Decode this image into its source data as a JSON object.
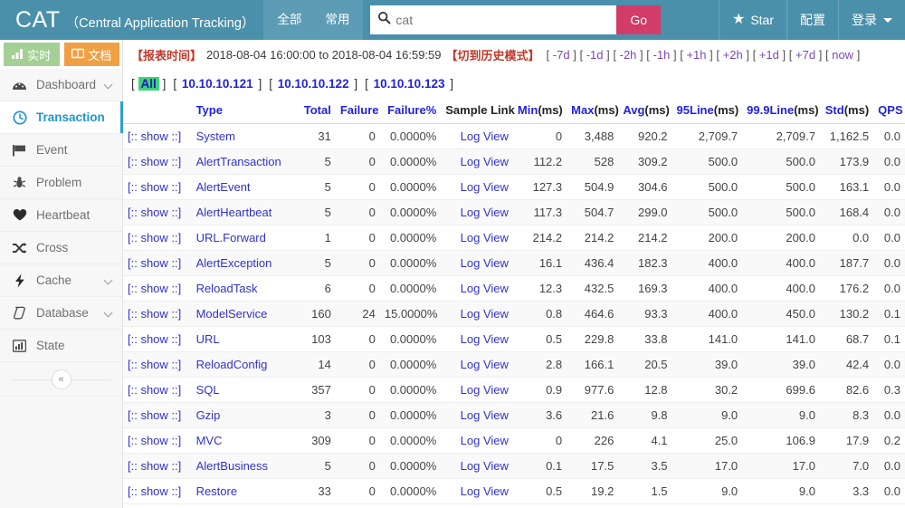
{
  "header": {
    "brand_short": "CAT",
    "brand_full": "（Central Application Tracking）",
    "nav_quick": [
      {
        "label": "全部",
        "name": "nav-all"
      },
      {
        "label": "常用",
        "name": "nav-common"
      }
    ],
    "search": {
      "icon": "search-icon",
      "value": "cat",
      "placeholder": "cat",
      "go_label": "Go",
      "go_color": "#d33b68"
    },
    "right_items": [
      {
        "label": "Star",
        "icon": "star-icon"
      },
      {
        "label": "配置",
        "icon": null
      },
      {
        "label": "登录",
        "icon": "chevron-down-icon"
      }
    ],
    "bg_color": "#4a90ab"
  },
  "sidebar": {
    "tab_buttons": [
      {
        "label": "实时",
        "icon": "bar-chart-icon",
        "color": "#a4cf95"
      },
      {
        "label": "文档",
        "icon": "book-icon",
        "color": "#f0a044"
      }
    ],
    "items": [
      {
        "label": "Dashboard",
        "icon": "dashboard-icon",
        "active": false,
        "expandable": true
      },
      {
        "label": "Transaction",
        "icon": "clock-icon",
        "active": true,
        "expandable": false
      },
      {
        "label": "Event",
        "icon": "flag-icon",
        "active": false,
        "expandable": false
      },
      {
        "label": "Problem",
        "icon": "bug-icon",
        "active": false,
        "expandable": false
      },
      {
        "label": "Heartbeat",
        "icon": "heart-icon",
        "active": false,
        "expandable": false
      },
      {
        "label": "Cross",
        "icon": "shuffle-icon",
        "active": false,
        "expandable": false
      },
      {
        "label": "Cache",
        "icon": "lightning-icon",
        "active": false,
        "expandable": true
      },
      {
        "label": "Database",
        "icon": "database-icon",
        "active": false,
        "expandable": true
      },
      {
        "label": "State",
        "icon": "chart-icon",
        "active": false,
        "expandable": false
      }
    ],
    "collapse_glyph": "«",
    "active_color": "#2196c9"
  },
  "toolbar": {
    "report_time_label": "【报表时间】",
    "time_range": "2018-08-04 16:00:00 to 2018-08-04 16:59:59",
    "history_mode_label": "【切到历史模式】",
    "jumps": [
      "-7d",
      "-1d",
      "-2h",
      "-1h",
      "+1h",
      "+2h",
      "+1d",
      "+7d",
      "now"
    ]
  },
  "ip_filter": {
    "items": [
      {
        "label": "All",
        "selected": true
      },
      {
        "label": "10.10.10.121",
        "selected": false
      },
      {
        "label": "10.10.10.122",
        "selected": false
      },
      {
        "label": "10.10.10.123",
        "selected": false
      }
    ],
    "selected_bg": "#3ed37e"
  },
  "table": {
    "columns": [
      {
        "key": "show",
        "label": "",
        "link": false,
        "align": "left"
      },
      {
        "key": "type",
        "label": "Type",
        "link": true,
        "align": "left"
      },
      {
        "key": "total",
        "label": "Total",
        "link": true,
        "align": "right"
      },
      {
        "key": "failure",
        "label": "Failure",
        "link": true,
        "align": "right"
      },
      {
        "key": "failure_pct",
        "label": "Failure%",
        "link": true,
        "align": "right"
      },
      {
        "key": "sample_link",
        "label": "Sample Link",
        "link": false,
        "align": "right"
      },
      {
        "key": "min",
        "label": "Min",
        "unit": "(ms)",
        "link": true,
        "align": "right"
      },
      {
        "key": "max",
        "label": "Max",
        "unit": "(ms)",
        "link": true,
        "align": "right"
      },
      {
        "key": "avg",
        "label": "Avg",
        "unit": "(ms)",
        "link": true,
        "align": "right"
      },
      {
        "key": "line95",
        "label": "95Line",
        "unit": "(ms)",
        "link": true,
        "align": "right"
      },
      {
        "key": "line999",
        "label": "99.9Line",
        "unit": "(ms)",
        "link": true,
        "align": "right"
      },
      {
        "key": "std",
        "label": "Std",
        "unit": "(ms)",
        "link": true,
        "align": "right"
      },
      {
        "key": "qps",
        "label": "QPS",
        "link": true,
        "align": "right"
      }
    ],
    "show_label": "[:: show ::]",
    "sample_link_label": "Log View",
    "rows": [
      {
        "type": "System",
        "total": "31",
        "failure": "0",
        "failure_pct": "0.0000%",
        "min": "0",
        "max": "3,488",
        "avg": "920.2",
        "line95": "2,709.7",
        "line999": "2,709.7",
        "std": "1,162.5",
        "qps": "0.0"
      },
      {
        "type": "AlertTransaction",
        "total": "5",
        "failure": "0",
        "failure_pct": "0.0000%",
        "min": "112.2",
        "max": "528",
        "avg": "309.2",
        "line95": "500.0",
        "line999": "500.0",
        "std": "173.9",
        "qps": "0.0"
      },
      {
        "type": "AlertEvent",
        "total": "5",
        "failure": "0",
        "failure_pct": "0.0000%",
        "min": "127.3",
        "max": "504.9",
        "avg": "304.6",
        "line95": "500.0",
        "line999": "500.0",
        "std": "163.1",
        "qps": "0.0"
      },
      {
        "type": "AlertHeartbeat",
        "total": "5",
        "failure": "0",
        "failure_pct": "0.0000%",
        "min": "117.3",
        "max": "504.7",
        "avg": "299.0",
        "line95": "500.0",
        "line999": "500.0",
        "std": "168.4",
        "qps": "0.0"
      },
      {
        "type": "URL.Forward",
        "total": "1",
        "failure": "0",
        "failure_pct": "0.0000%",
        "min": "214.2",
        "max": "214.2",
        "avg": "214.2",
        "line95": "200.0",
        "line999": "200.0",
        "std": "0.0",
        "qps": "0.0"
      },
      {
        "type": "AlertException",
        "total": "5",
        "failure": "0",
        "failure_pct": "0.0000%",
        "min": "16.1",
        "max": "436.4",
        "avg": "182.3",
        "line95": "400.0",
        "line999": "400.0",
        "std": "187.7",
        "qps": "0.0"
      },
      {
        "type": "ReloadTask",
        "total": "6",
        "failure": "0",
        "failure_pct": "0.0000%",
        "min": "12.3",
        "max": "432.5",
        "avg": "169.3",
        "line95": "400.0",
        "line999": "400.0",
        "std": "176.2",
        "qps": "0.0"
      },
      {
        "type": "ModelService",
        "total": "160",
        "failure": "24",
        "failure_pct": "15.0000%",
        "min": "0.8",
        "max": "464.6",
        "avg": "93.3",
        "line95": "400.0",
        "line999": "450.0",
        "std": "130.2",
        "qps": "0.1"
      },
      {
        "type": "URL",
        "total": "103",
        "failure": "0",
        "failure_pct": "0.0000%",
        "min": "0.5",
        "max": "229.8",
        "avg": "33.8",
        "line95": "141.0",
        "line999": "141.0",
        "std": "68.7",
        "qps": "0.1"
      },
      {
        "type": "ReloadConfig",
        "total": "14",
        "failure": "0",
        "failure_pct": "0.0000%",
        "min": "2.8",
        "max": "166.1",
        "avg": "20.5",
        "line95": "39.0",
        "line999": "39.0",
        "std": "42.4",
        "qps": "0.0"
      },
      {
        "type": "SQL",
        "total": "357",
        "failure": "0",
        "failure_pct": "0.0000%",
        "min": "0.9",
        "max": "977.6",
        "avg": "12.8",
        "line95": "30.2",
        "line999": "699.6",
        "std": "82.6",
        "qps": "0.3"
      },
      {
        "type": "Gzip",
        "total": "3",
        "failure": "0",
        "failure_pct": "0.0000%",
        "min": "3.6",
        "max": "21.6",
        "avg": "9.8",
        "line95": "9.0",
        "line999": "9.0",
        "std": "8.3",
        "qps": "0.0"
      },
      {
        "type": "MVC",
        "total": "309",
        "failure": "0",
        "failure_pct": "0.0000%",
        "min": "0",
        "max": "226",
        "avg": "4.1",
        "line95": "25.0",
        "line999": "106.9",
        "std": "17.9",
        "qps": "0.2"
      },
      {
        "type": "AlertBusiness",
        "total": "5",
        "failure": "0",
        "failure_pct": "0.0000%",
        "min": "0.1",
        "max": "17.5",
        "avg": "3.5",
        "line95": "17.0",
        "line999": "17.0",
        "std": "7.0",
        "qps": "0.0"
      },
      {
        "type": "Restore",
        "total": "33",
        "failure": "0",
        "failure_pct": "0.0000%",
        "min": "0.5",
        "max": "19.2",
        "avg": "1.5",
        "line95": "9.0",
        "line999": "9.0",
        "std": "3.3",
        "qps": "0.0"
      }
    ]
  }
}
